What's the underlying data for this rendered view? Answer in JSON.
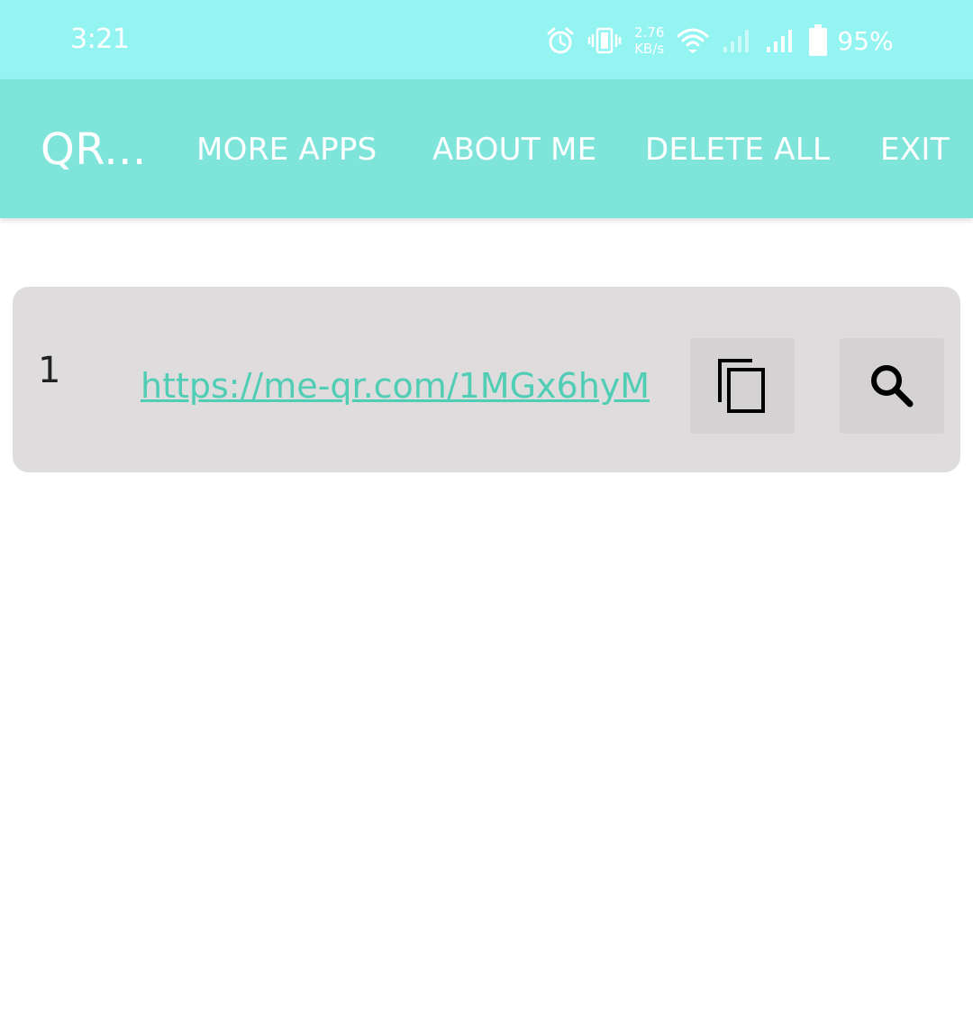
{
  "status_bar": {
    "time": "3:21",
    "net_speed_value": "2.76",
    "net_speed_unit": "KB/s",
    "battery_percent": "95%",
    "icons": [
      "alarm-icon",
      "vibrate-icon",
      "wifi-icon",
      "signal-sim1-icon",
      "signal-sim2-icon",
      "battery-icon"
    ]
  },
  "app_bar": {
    "title": "QR...",
    "menu": {
      "more_apps": "MORE APPS",
      "about_me": "ABOUT ME",
      "delete_all": "DELETE ALL",
      "exit": "EXIT"
    }
  },
  "history": [
    {
      "index": "1",
      "url": "https://me-qr.com/1MGx6hyM",
      "actions": [
        "copy-icon",
        "search-icon"
      ]
    }
  ],
  "colors": {
    "status_bar": "#93f4f1",
    "app_bar": "#7fe5db",
    "link": "#4fcdb5",
    "card": "#dedcdc",
    "button": "#d4d2d2"
  }
}
